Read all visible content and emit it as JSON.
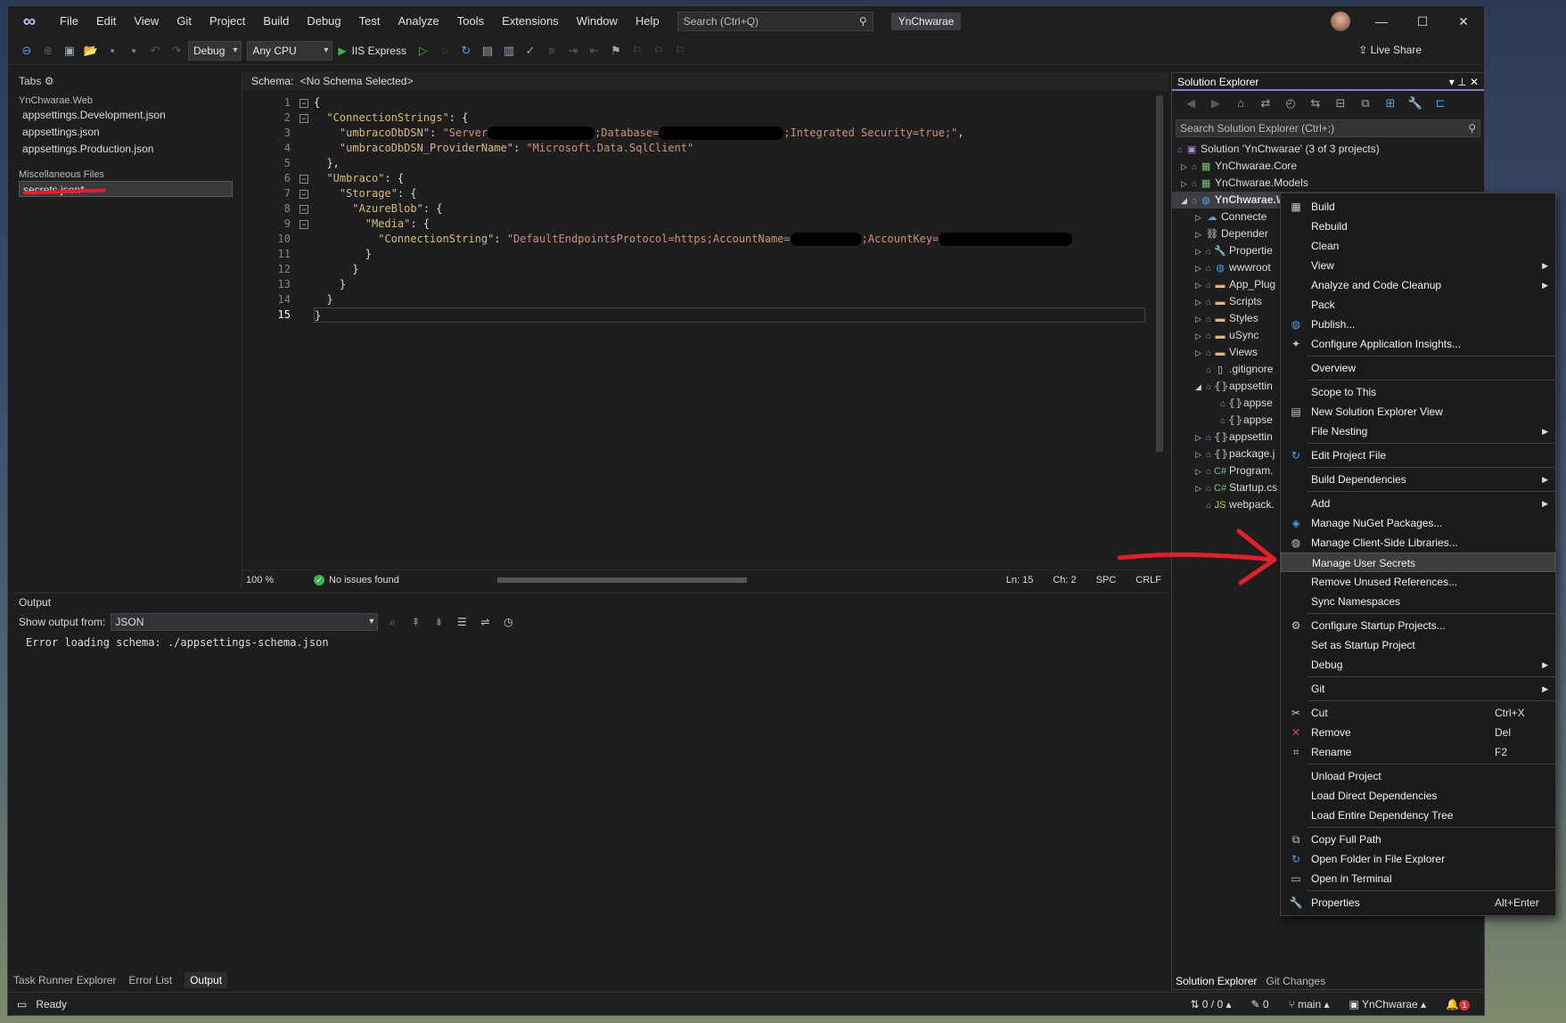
{
  "menu": [
    "File",
    "Edit",
    "View",
    "Git",
    "Project",
    "Build",
    "Debug",
    "Test",
    "Analyze",
    "Tools",
    "Extensions",
    "Window",
    "Help"
  ],
  "search": {
    "placeholder": "Search (Ctrl+Q)"
  },
  "solution_name": "YnChwarae",
  "toolbar": {
    "config": "Debug",
    "platform": "Any CPU",
    "run_label": "IIS Express",
    "live_share": "Live Share"
  },
  "tabs_panel": {
    "title": "Tabs",
    "group1": "YnChwarae.Web",
    "group1_files": [
      "appsettings.Development.json",
      "appsettings.json",
      "appsettings.Production.json"
    ],
    "group2": "Miscellaneous Files",
    "group2_files": [
      "secrets.json*"
    ]
  },
  "editor": {
    "schema_label": "Schema:",
    "schema_value": "<No Schema Selected>",
    "line_numbers": [
      "1",
      "2",
      "3",
      "4",
      "5",
      "6",
      "7",
      "8",
      "9",
      "10",
      "11",
      "12",
      "13",
      "14",
      "15"
    ],
    "code": {
      "l1": "{",
      "l2_key": "\"ConnectionStrings\"",
      "l2_rest": ": {",
      "l3_key": "\"umbracoDbDSN\"",
      "l3_a": "\"Server",
      "l3_b": ";Database=",
      "l3_c": ";Integrated Security=true;\"",
      "l3_d": ",",
      "l4_key": "\"umbracoDbDSN_ProviderName\"",
      "l4_val": "\"Microsoft.Data.SqlClient\"",
      "l5": "},",
      "l6_key": "\"Umbraco\"",
      "l6_rest": ": {",
      "l7_key": "\"Storage\"",
      "l7_rest": ": {",
      "l8_key": "\"AzureBlob\"",
      "l8_rest": ": {",
      "l9_key": "\"Media\"",
      "l9_rest": ": {",
      "l10_key": "\"ConnectionString\"",
      "l10_a": "\"DefaultEndpointsProtocol=https;AccountName=",
      "l10_b": ";AccountKey=",
      "l11": "}",
      "l12": "}",
      "l13": "}",
      "l14": "}",
      "l15": "}"
    },
    "zoom": "100 %",
    "issues": "No issues found",
    "ln": "Ln: 15",
    "ch": "Ch: 2",
    "spc": "SPC",
    "crlf": "CRLF"
  },
  "output": {
    "title": "Output",
    "show_from_label": "Show output from:",
    "show_from_value": "JSON",
    "text": "Error loading schema: ./appsettings-schema.json"
  },
  "bottom_tabs": [
    "Task Runner Explorer",
    "Error List",
    "Output"
  ],
  "solution_explorer": {
    "title": "Solution Explorer",
    "search_placeholder": "Search Solution Explorer (Ctrl+;)",
    "solution": "Solution 'YnChwarae' (3 of 3 projects)",
    "projects": [
      "YnChwarae.Core",
      "YnChwarae.Models",
      "YnChwarae.Web"
    ],
    "children": [
      "Connecte",
      "Depender",
      "Propertie",
      "wwwroot",
      "App_Plug",
      "Scripts",
      "Styles",
      "uSync",
      "Views",
      ".gitignore",
      "appsettin",
      "appse",
      "appse",
      "appsettin",
      "package.j",
      "Program.",
      "Startup.cs",
      "webpack."
    ],
    "tabs": [
      "Solution Explorer",
      "Git Changes"
    ]
  },
  "context_menu": {
    "items": [
      {
        "label": "Build",
        "icon": "build-icon"
      },
      {
        "label": "Rebuild"
      },
      {
        "label": "Clean"
      },
      {
        "label": "View",
        "sub": true
      },
      {
        "label": "Analyze and Code Cleanup",
        "sub": true
      },
      {
        "label": "Pack"
      },
      {
        "label": "Publish...",
        "icon": "globe-icon"
      },
      {
        "label": "Configure Application Insights...",
        "icon": "insights-icon"
      },
      {
        "sep": true
      },
      {
        "label": "Overview"
      },
      {
        "sep": true
      },
      {
        "label": "Scope to This"
      },
      {
        "label": "New Solution Explorer View",
        "icon": "window-icon"
      },
      {
        "label": "File Nesting",
        "sub": true
      },
      {
        "sep": true
      },
      {
        "label": "Edit Project File",
        "icon": "edit-icon"
      },
      {
        "sep": true
      },
      {
        "label": "Build Dependencies",
        "sub": true
      },
      {
        "sep": true
      },
      {
        "label": "Add",
        "sub": true
      },
      {
        "label": "Manage NuGet Packages...",
        "icon": "nuget-icon"
      },
      {
        "label": "Manage Client-Side Libraries...",
        "icon": "library-icon"
      },
      {
        "label": "Manage User Secrets",
        "highlight": true
      },
      {
        "label": "Remove Unused References..."
      },
      {
        "label": "Sync Namespaces"
      },
      {
        "sep": true
      },
      {
        "label": "Configure Startup Projects...",
        "icon": "gear-icon"
      },
      {
        "label": "Set as Startup Project"
      },
      {
        "label": "Debug",
        "sub": true
      },
      {
        "sep": true
      },
      {
        "label": "Git",
        "sub": true
      },
      {
        "sep": true
      },
      {
        "label": "Cut",
        "icon": "scissors-icon",
        "shortcut": "Ctrl+X"
      },
      {
        "label": "Remove",
        "icon": "remove-icon",
        "shortcut": "Del"
      },
      {
        "label": "Rename",
        "icon": "rename-icon",
        "shortcut": "F2"
      },
      {
        "sep": true
      },
      {
        "label": "Unload Project"
      },
      {
        "label": "Load Direct Dependencies"
      },
      {
        "label": "Load Entire Dependency Tree"
      },
      {
        "sep": true
      },
      {
        "label": "Copy Full Path",
        "icon": "copy-icon"
      },
      {
        "label": "Open Folder in File Explorer",
        "icon": "folder-open-icon"
      },
      {
        "label": "Open in Terminal",
        "icon": "terminal-icon"
      },
      {
        "sep": true
      },
      {
        "label": "Properties",
        "icon": "wrench-icon",
        "shortcut": "Alt+Enter"
      }
    ]
  },
  "statusbar": {
    "ready": "Ready",
    "changes": "0 / 0",
    "pencil": "0",
    "branch": "main",
    "repo": "YnChwarae",
    "notifications": "1"
  },
  "colors": {
    "accent": "#8e7cc3",
    "annotation": "#e0202a"
  }
}
